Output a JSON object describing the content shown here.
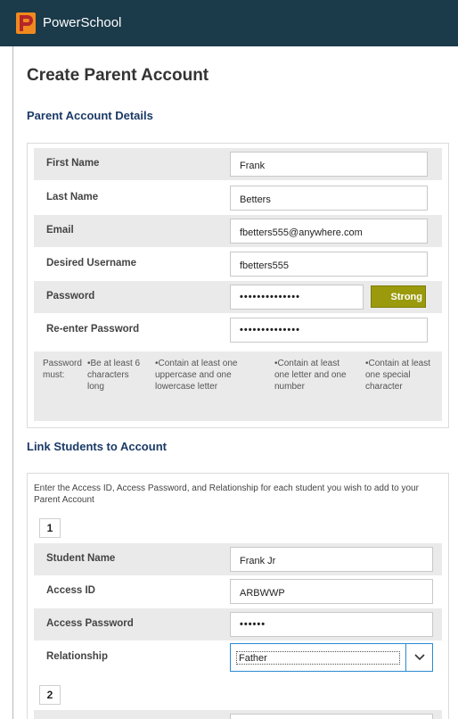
{
  "header": {
    "brand": "PowerSchool"
  },
  "page_title": "Create Parent Account",
  "parent_section": {
    "title": "Parent Account Details",
    "fields": [
      {
        "label": "First Name",
        "value": "Frank"
      },
      {
        "label": "Last Name",
        "value": "Betters"
      },
      {
        "label": "Email",
        "value": "fbetters555@anywhere.com"
      },
      {
        "label": "Desired Username",
        "value": "fbetters555"
      },
      {
        "label": "Password",
        "value": "••••••••••••••"
      },
      {
        "label": "Re-enter Password",
        "value": "••••••••••••••"
      }
    ],
    "strength": "Strong",
    "rules": {
      "label": "Password must:",
      "items": [
        "•Be at least 6 characters long",
        "•Contain at least one uppercase and one lowercase letter",
        "•Contain at least one letter and one number",
        "•Contain at least one special character"
      ]
    }
  },
  "students_section": {
    "title": "Link Students to Account",
    "intro": "Enter the Access ID, Access Password, and Relationship for each student you wish to add to your Parent Account",
    "student_numbers": [
      "1",
      "2"
    ],
    "fields": [
      {
        "label": "Student Name",
        "value": "Frank Jr"
      },
      {
        "label": "Access ID",
        "value": "ARBWWP"
      },
      {
        "label": "Access Password",
        "value": "••••••"
      },
      {
        "label": "Relationship",
        "value": "Father"
      }
    ]
  },
  "colors": {
    "header_bg": "#1b3a4a",
    "section_title": "#1b3a66",
    "strength_badge": "#9a9a0c",
    "select_border": "#2a8ad0"
  }
}
